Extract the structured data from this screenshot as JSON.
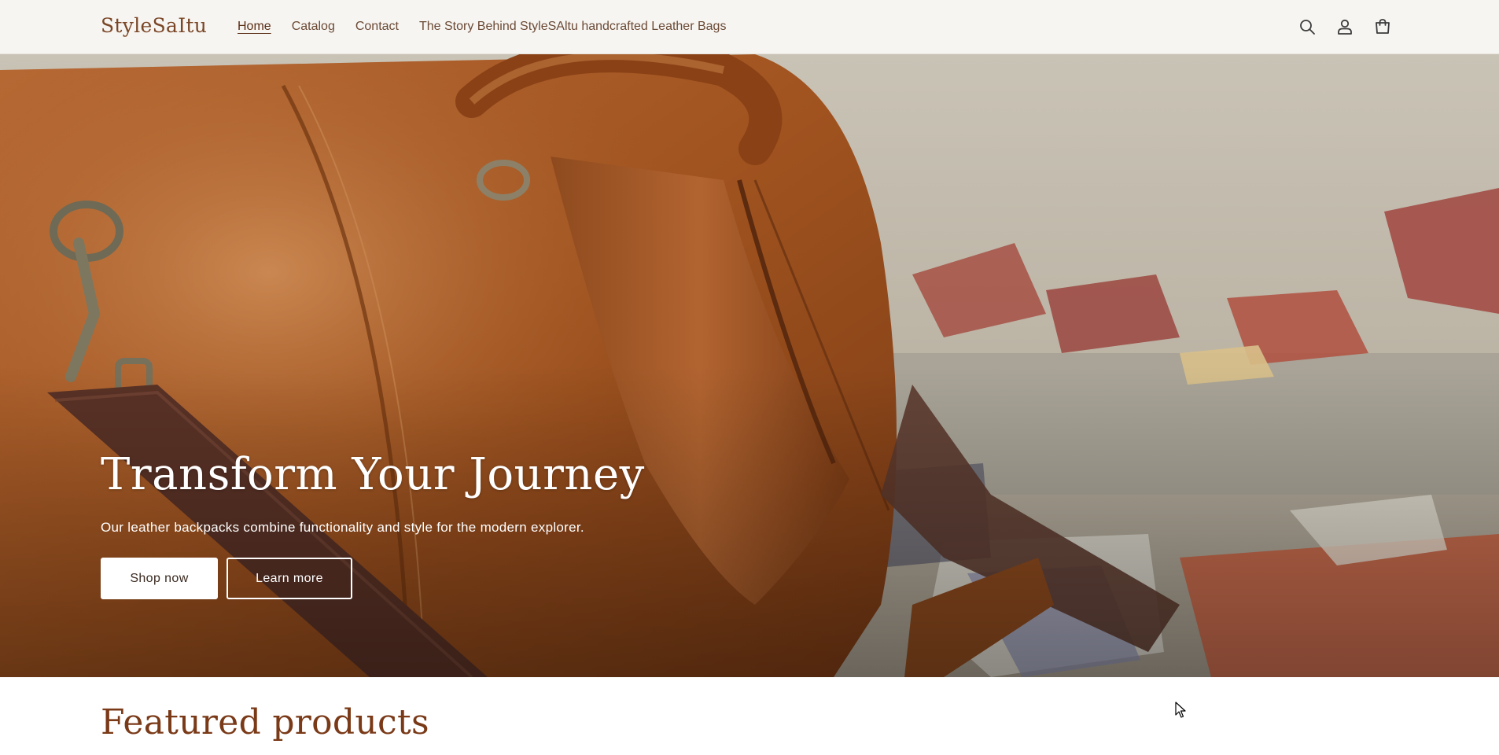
{
  "header": {
    "logo": "StyleSaItu",
    "nav": [
      {
        "label": "Home",
        "active": true
      },
      {
        "label": "Catalog",
        "active": false
      },
      {
        "label": "Contact",
        "active": false
      },
      {
        "label": "The Story Behind StyleSAltu handcrafted Leather Bags",
        "active": false
      }
    ],
    "icons": [
      "search-icon",
      "account-icon",
      "cart-icon"
    ]
  },
  "hero": {
    "title": "Transform Your Journey",
    "subtitle": "Our leather backpacks combine functionality and style for the modern explorer.",
    "primary_button": "Shop now",
    "secondary_button": "Learn more"
  },
  "featured": {
    "title": "Featured products"
  },
  "colors": {
    "header_bg": "#f7f5f2",
    "logo": "#7a4626",
    "nav_text": "#6b4a35",
    "featured_title": "#7a3a18",
    "leather": "#a45a2a"
  }
}
